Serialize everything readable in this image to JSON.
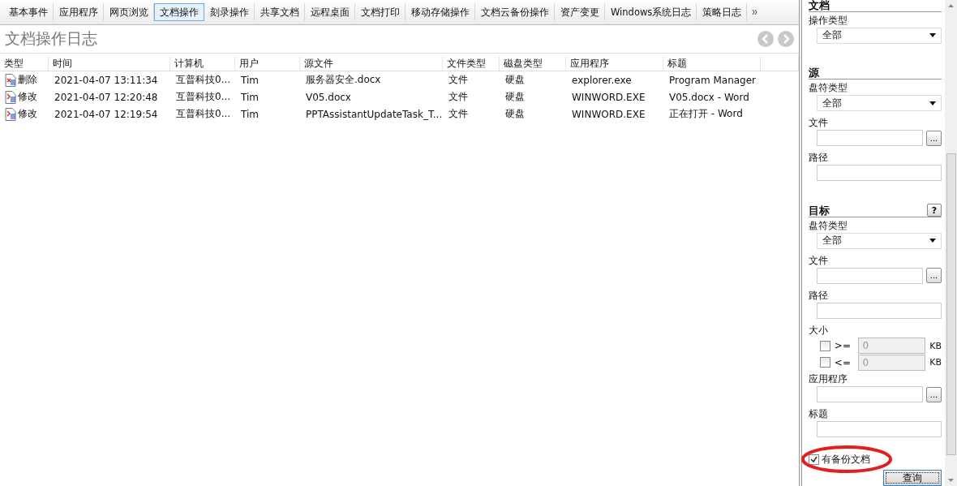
{
  "tabs": [
    {
      "label": "基本事件",
      "selected": false
    },
    {
      "label": "应用程序",
      "selected": false
    },
    {
      "label": "网页浏览",
      "selected": false
    },
    {
      "label": "文档操作",
      "selected": true
    },
    {
      "label": "刻录操作",
      "selected": false
    },
    {
      "label": "共享文档",
      "selected": false
    },
    {
      "label": "远程桌面",
      "selected": false
    },
    {
      "label": "文档打印",
      "selected": false
    },
    {
      "label": "移动存储操作",
      "selected": false
    },
    {
      "label": "文档云备份操作",
      "selected": false
    },
    {
      "label": "资产变更",
      "selected": false
    },
    {
      "label": "Windows系统日志",
      "selected": false
    },
    {
      "label": "策略日志",
      "selected": false
    }
  ],
  "page_title": "文档操作日志",
  "table": {
    "columns": [
      "类型",
      "时间",
      "计算机",
      "用户",
      "源文件",
      "文件类型",
      "磁盘类型",
      "应用程序",
      "标题"
    ],
    "rows": [
      {
        "kind": "delete",
        "cells": [
          "删除",
          "2021-04-07 13:11:34",
          "互普科技0...",
          "Tim",
          "服务器安全.docx",
          "文件",
          "硬盘",
          "explorer.exe",
          "Program Manager"
        ]
      },
      {
        "kind": "modify",
        "cells": [
          "修改",
          "2021-04-07 12:20:48",
          "互普科技0...",
          "Tim",
          "V05.docx",
          "文件",
          "硬盘",
          "WINWORD.EXE",
          "V05.docx - Word"
        ]
      },
      {
        "kind": "modify",
        "cells": [
          "修改",
          "2021-04-07 12:19:54",
          "互普科技0...",
          "Tim",
          "PPTAssistantUpdateTask_T...",
          "文件",
          "硬盘",
          "WINWORD.EXE",
          "正在打开 - Word"
        ]
      }
    ]
  },
  "filter_panel": [
    {
      "kind": "heading",
      "text": "文档"
    },
    {
      "kind": "label",
      "text": "操作类型"
    },
    {
      "kind": "select",
      "value": "全部"
    },
    {
      "kind": "heading",
      "text": "源"
    },
    {
      "kind": "label",
      "text": "盘符类型"
    },
    {
      "kind": "select",
      "value": "全部"
    },
    {
      "kind": "label",
      "text": "文件"
    },
    {
      "kind": "browse",
      "button": "..."
    },
    {
      "kind": "label",
      "text": "路径"
    },
    {
      "kind": "input"
    },
    {
      "kind": "heading",
      "text": "目标",
      "help": "?"
    },
    {
      "kind": "label",
      "text": "盘符类型"
    },
    {
      "kind": "select",
      "value": "全部"
    },
    {
      "kind": "label",
      "text": "文件"
    },
    {
      "kind": "browse",
      "button": "..."
    },
    {
      "kind": "label",
      "text": "路径"
    },
    {
      "kind": "input"
    },
    {
      "kind": "label",
      "text": "大小"
    },
    {
      "kind": "size",
      "checked": false,
      "operator": ">=",
      "value": "0",
      "unit": "KB"
    },
    {
      "kind": "size",
      "checked": false,
      "operator": "<=",
      "value": "0",
      "unit": "KB"
    },
    {
      "kind": "label",
      "text": "应用程序"
    },
    {
      "kind": "browse",
      "button": "..."
    },
    {
      "kind": "label",
      "text": "标题"
    },
    {
      "kind": "input"
    },
    {
      "kind": "checkbox",
      "label": "有备份文档",
      "checked": true,
      "circled": true
    },
    {
      "kind": "button",
      "label": "查询"
    }
  ]
}
